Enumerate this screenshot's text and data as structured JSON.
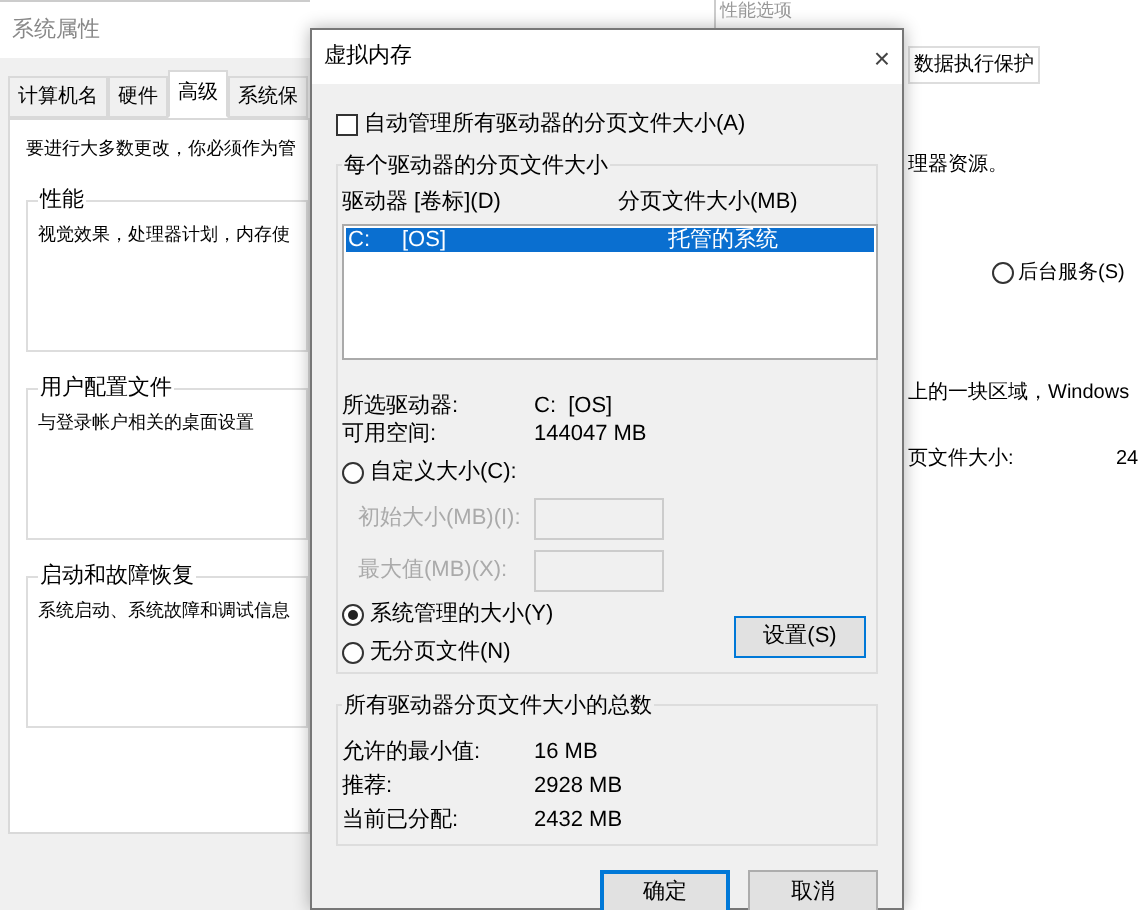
{
  "system_properties": {
    "title": "系统属性",
    "tabs": [
      {
        "label": "计算机名",
        "selected": false
      },
      {
        "label": "硬件",
        "selected": false
      },
      {
        "label": "高级",
        "selected": true
      },
      {
        "label": "系统保",
        "selected": false
      }
    ],
    "intro": "要进行大多数更改，你必须作为管",
    "groups": [
      {
        "title": "性能",
        "text": "视觉效果，处理器计划，内存使"
      },
      {
        "title": "用户配置文件",
        "text": "与登录帐户相关的桌面设置"
      },
      {
        "title": "启动和故障恢复",
        "text": "系统启动、系统故障和调试信息"
      }
    ]
  },
  "performance_options": {
    "title": "性能选项",
    "tab": "数据执行保护",
    "texts": [
      "理器资源。",
      "上的一块区域，Windows",
      "页文件大小:",
      "24"
    ],
    "radio": {
      "label": "后台服务(S)",
      "selected": false
    }
  },
  "virtual_memory": {
    "title": "虚拟内存",
    "close": "×",
    "auto_manage": {
      "label": "自动管理所有驱动器的分页文件大小(A)",
      "checked": false
    },
    "per_drive": {
      "title": "每个驱动器的分页文件大小",
      "columns": [
        "驱动器 [卷标](D)",
        "分页文件大小(MB)"
      ],
      "rows": [
        {
          "drive": "C:",
          "label": "[OS]",
          "size": "托管的系统",
          "selected": true
        }
      ],
      "info": [
        {
          "label": "所选驱动器:",
          "value": "C:  [OS]"
        },
        {
          "label": "可用空间:",
          "value": "144047 MB"
        }
      ],
      "options": [
        {
          "kind": "radio",
          "label": "自定义大小(C):",
          "selected": false
        },
        {
          "kind": "field",
          "label": "初始大小(MB)(I):",
          "disabled": true
        },
        {
          "kind": "field",
          "label": "最大值(MB)(X):",
          "disabled": true
        },
        {
          "kind": "radio",
          "label": "系统管理的大小(Y)",
          "selected": true
        },
        {
          "kind": "radio",
          "label": "无分页文件(N)",
          "selected": false
        }
      ],
      "set_button": "设置(S)"
    },
    "totals": {
      "title": "所有驱动器分页文件大小的总数",
      "rows": [
        {
          "label": "允许的最小值:",
          "value": "16 MB"
        },
        {
          "label": "推荐:",
          "value": "2928 MB"
        },
        {
          "label": "当前已分配:",
          "value": "2432 MB"
        }
      ]
    },
    "buttons": [
      {
        "label": "确定",
        "default": true
      },
      {
        "label": "取消",
        "default": false
      }
    ]
  }
}
